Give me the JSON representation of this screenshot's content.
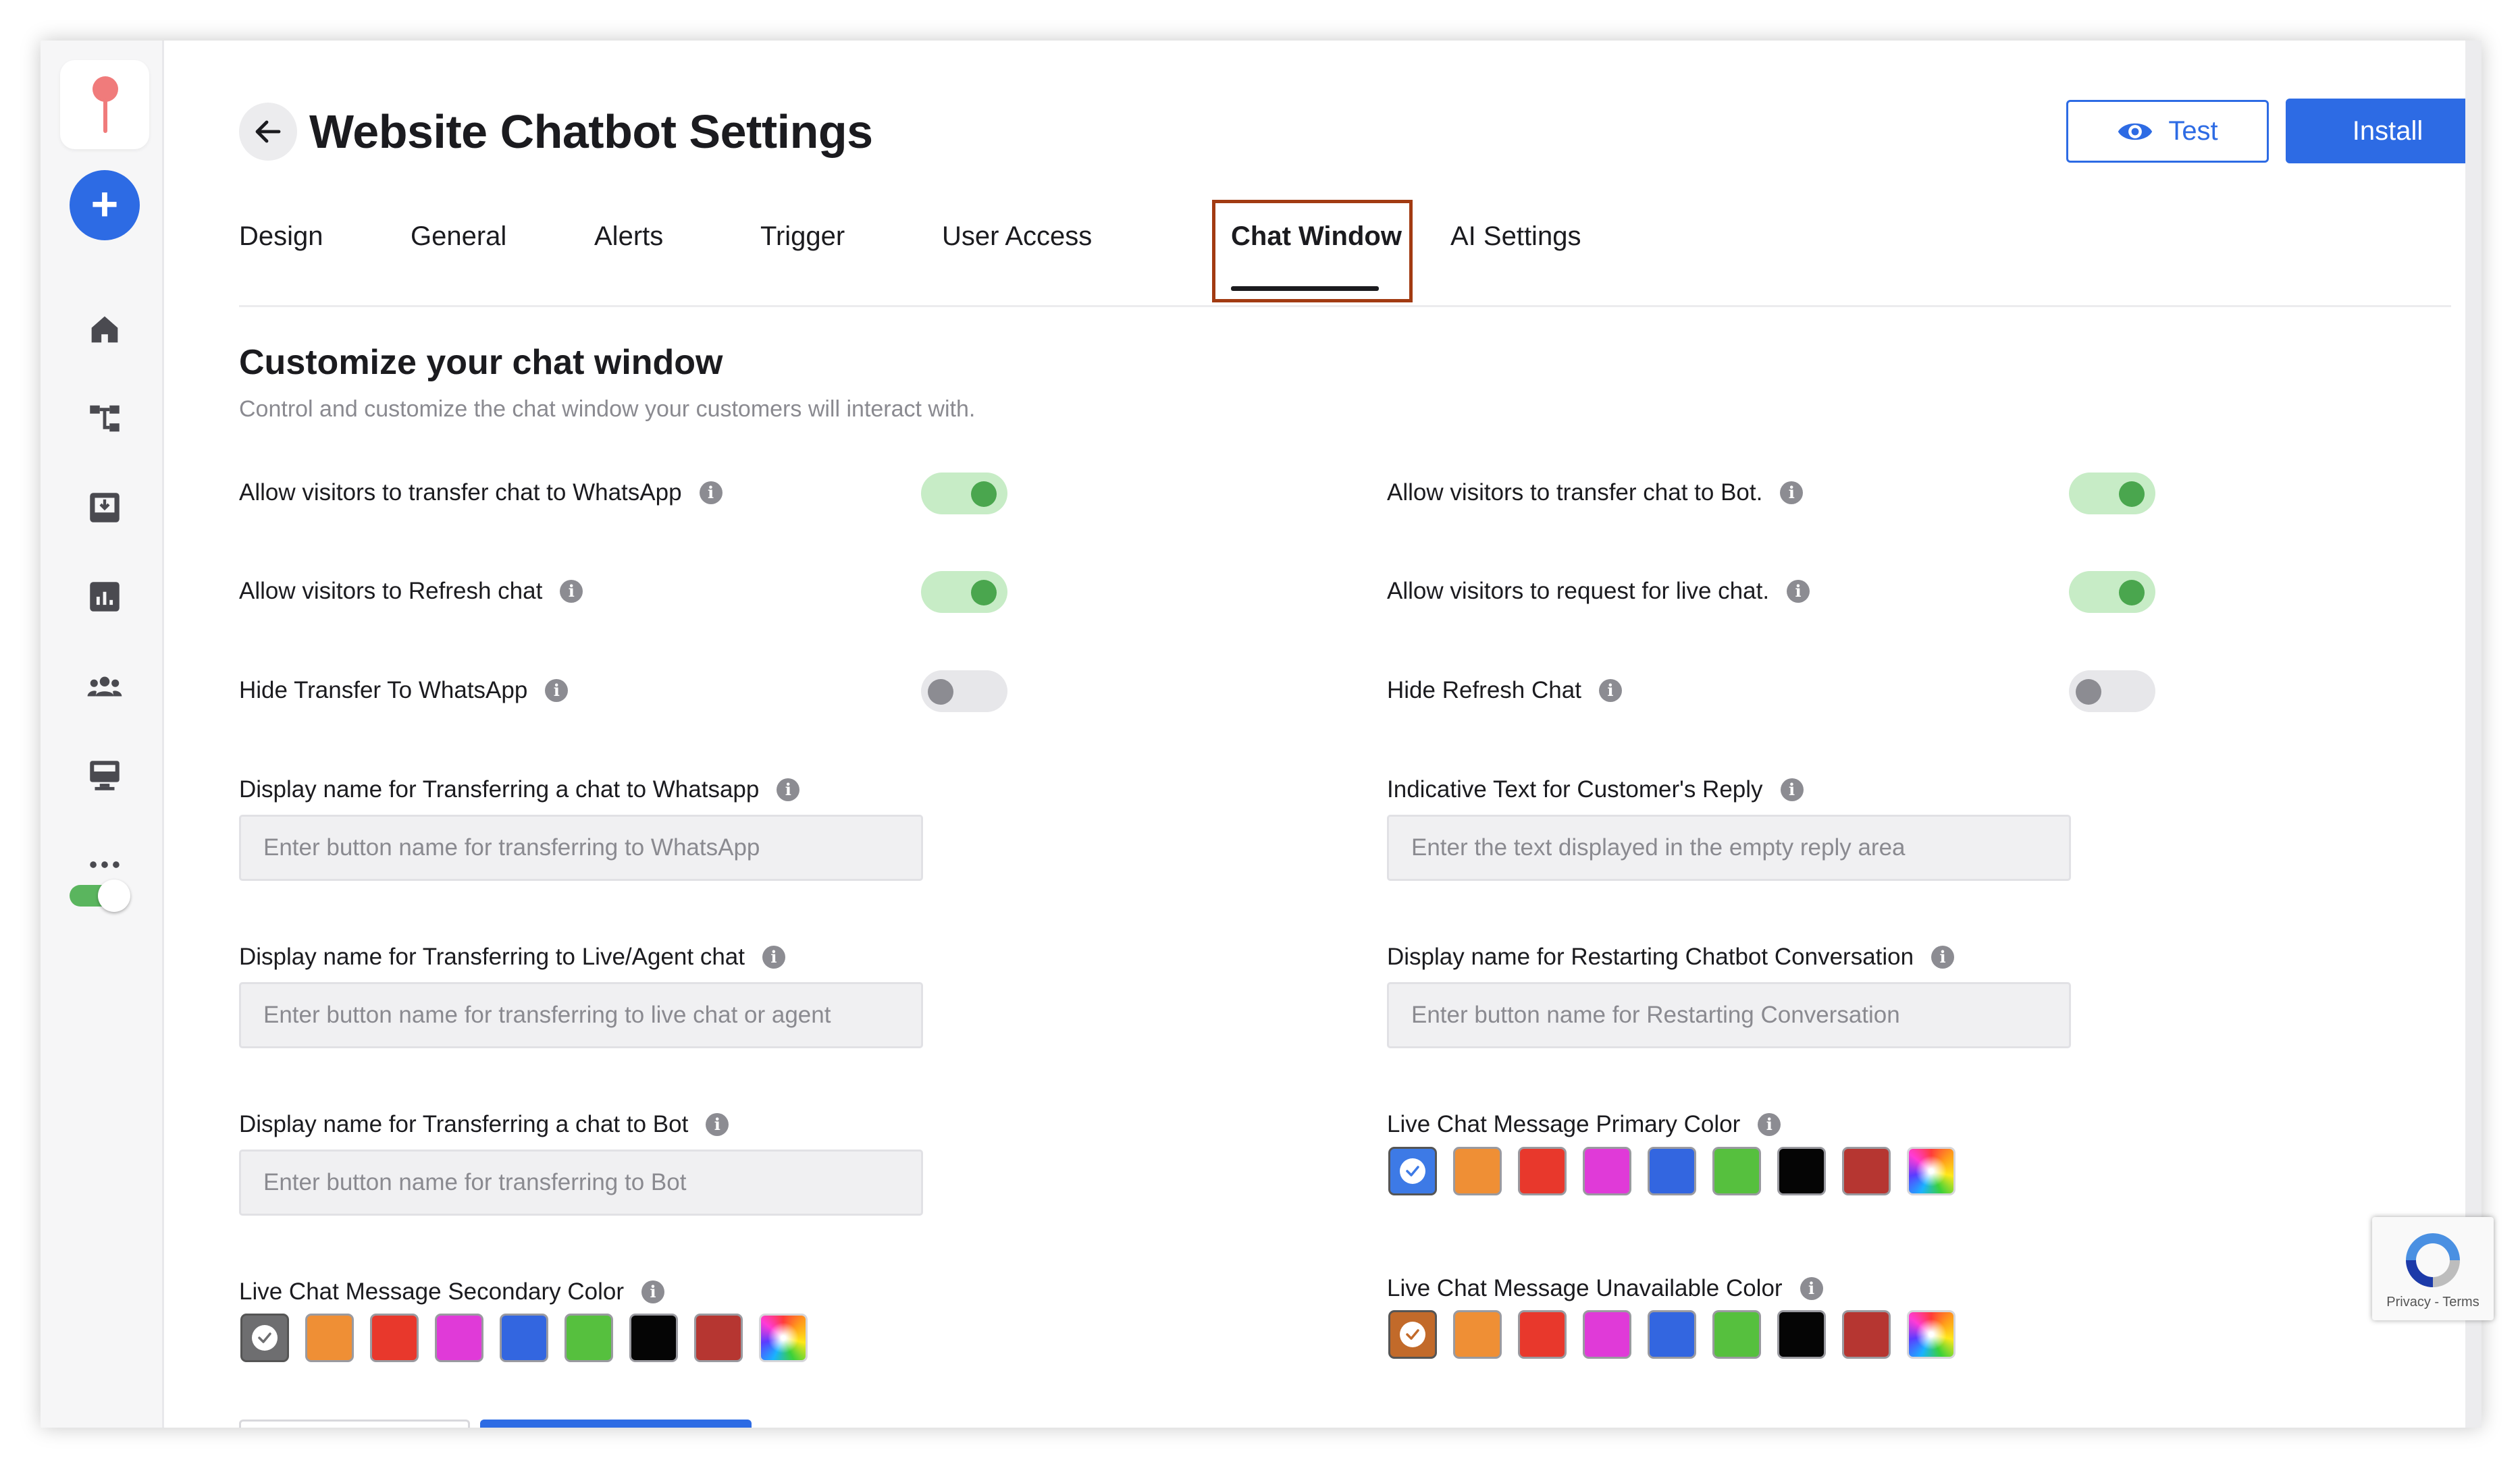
{
  "page": {
    "title": "Website Chatbot Settings",
    "test_label": "Test",
    "install_label": "Install"
  },
  "tabs": [
    {
      "label": "Design"
    },
    {
      "label": "General"
    },
    {
      "label": "Alerts"
    },
    {
      "label": "Trigger"
    },
    {
      "label": "User Access"
    },
    {
      "label": "Chat Window",
      "active": true
    },
    {
      "label": "AI Settings"
    }
  ],
  "section": {
    "title": "Customize your chat window",
    "subtitle": "Control and customize the chat window your customers will interact with."
  },
  "toggles": [
    {
      "label": "Allow visitors to transfer chat to WhatsApp",
      "on": true
    },
    {
      "label": "Allow visitors to transfer chat to Bot.",
      "on": true
    },
    {
      "label": "Allow visitors to Refresh chat",
      "on": true
    },
    {
      "label": "Allow visitors to request for live chat.",
      "on": true
    },
    {
      "label": "Hide Transfer To WhatsApp",
      "on": false
    },
    {
      "label": "Hide Refresh Chat",
      "on": false
    }
  ],
  "inputs": [
    {
      "label": "Display name for Transferring a chat to Whatsapp",
      "placeholder": "Enter button name for transferring to WhatsApp",
      "value": ""
    },
    {
      "label": "Indicative Text for Customer's Reply",
      "placeholder": "Enter the text displayed in the empty reply area",
      "value": ""
    },
    {
      "label": "Display name for Transferring to Live/Agent chat",
      "placeholder": "Enter button name for transferring to live chat or agent",
      "value": ""
    },
    {
      "label": "Display name for Restarting Chatbot Conversation",
      "placeholder": "Enter button name for Restarting Conversation",
      "value": ""
    },
    {
      "label": "Display name for Transferring a chat to Bot",
      "placeholder": "Enter button name for transferring to Bot",
      "value": ""
    }
  ],
  "color_pickers": {
    "primary": {
      "label": "Live Chat Message Primary Color",
      "selected": 0
    },
    "secondary": {
      "label": "Live Chat Message Secondary Color",
      "selected": 0
    },
    "unavailable": {
      "label": "Live Chat Message Unavailable Color",
      "selected": 0
    }
  },
  "colors": {
    "primary_swatches": [
      "#3d7ae6",
      "#ef8f35",
      "#e8382c",
      "#e03ad8",
      "#3366e0",
      "#56c03e",
      "#050505",
      "#b63631"
    ],
    "secondary_swatches": [
      "#6e6e70",
      "#ef8f35",
      "#e8382c",
      "#e03ad8",
      "#3366e0",
      "#56c03e",
      "#050505",
      "#b63631"
    ],
    "unavailable_swatches": [
      "#c26a2a",
      "#ef8f35",
      "#e8382c",
      "#e03ad8",
      "#3366e0",
      "#56c03e",
      "#050505",
      "#b63631"
    ],
    "accent": "#2d6be4",
    "toggle_on": "#4aa64e",
    "active_tab_highlight": "#a23b12"
  },
  "sidebar": {
    "icons": [
      "logo-pin-icon",
      "plus-icon",
      "home-icon",
      "flow-icon",
      "inbox-icon",
      "analytics-icon",
      "team-icon",
      "monitor-icon",
      "more-icon",
      "status-toggle"
    ]
  },
  "recaptcha": {
    "text": "Privacy - Terms"
  }
}
